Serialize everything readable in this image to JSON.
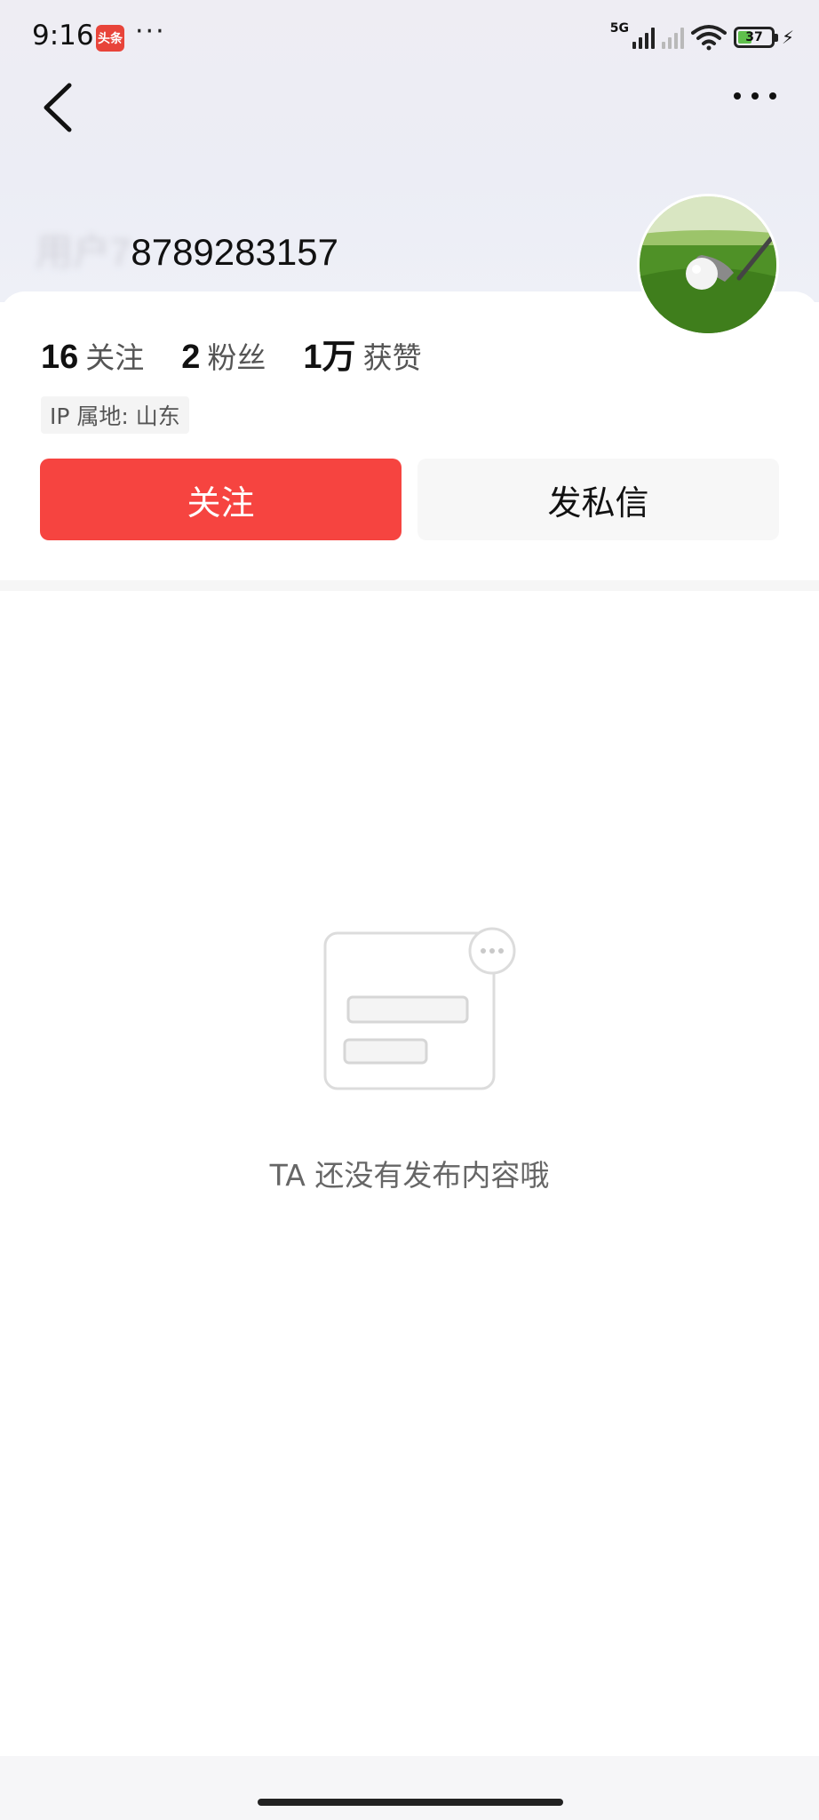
{
  "status_bar": {
    "time": "9:16",
    "app_badge": "头条",
    "more": "···",
    "network": "5G",
    "battery": "37",
    "charging_icon": "bolt-icon"
  },
  "nav": {
    "back_icon": "chevron-left-icon",
    "more_icon": "more-dots-icon"
  },
  "profile": {
    "username_hidden": "用户7",
    "username_visible": "8789283157",
    "avatar": "golf-ball-avatar"
  },
  "stats": [
    {
      "num": "16",
      "label": "关注"
    },
    {
      "num": "2",
      "label": "粉丝"
    },
    {
      "num": "1万",
      "label": "获赞"
    }
  ],
  "ip_location": "IP 属地: 山东",
  "actions": {
    "follow": "关注",
    "message": "发私信"
  },
  "empty_state": {
    "text": "TA 还没有发布内容哦",
    "icon": "empty-content-icon"
  },
  "colors": {
    "accent": "#f64440",
    "hero_bg": "#eeedf3"
  }
}
